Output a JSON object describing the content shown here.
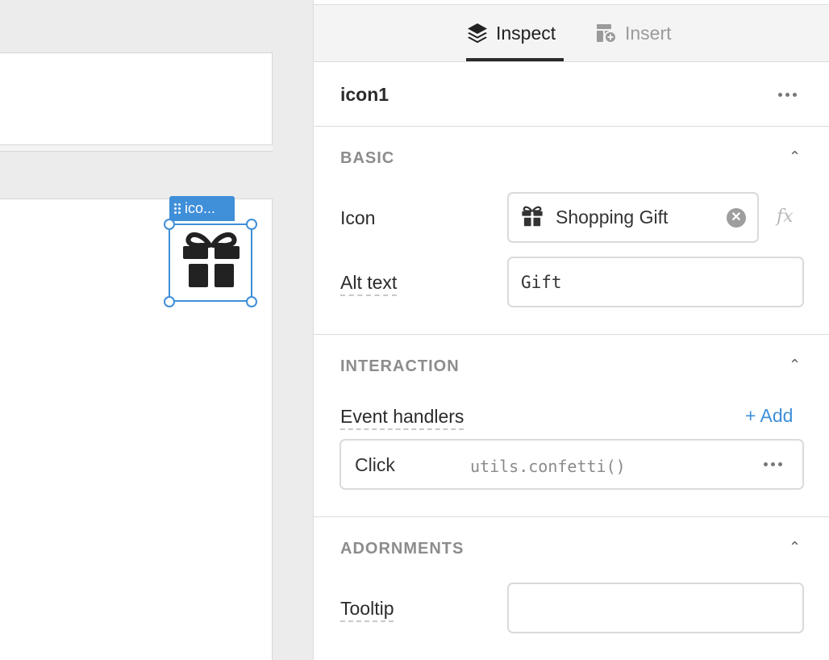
{
  "tabs": {
    "inspect_label": "Inspect",
    "insert_label": "Insert",
    "active": "inspect"
  },
  "component": {
    "name": "icon1",
    "selection_tag": "ico..."
  },
  "sections": {
    "basic": {
      "title": "BASIC",
      "icon_label": "Icon",
      "icon_value": "Shopping Gift",
      "icon_name": "gift-icon",
      "fx_label": "fx",
      "alt_label": "Alt text",
      "alt_value": "Gift"
    },
    "interaction": {
      "title": "INTERACTION",
      "handlers_label": "Event handlers",
      "add_label": "+ Add",
      "handlers": [
        {
          "event": "Click",
          "action": "utils.confetti()"
        }
      ]
    },
    "adornments": {
      "title": "ADORNMENTS",
      "tooltip_label": "Tooltip",
      "tooltip_value": ""
    }
  },
  "colors": {
    "accent": "#3f8fd9",
    "section_title": "#8c8c8c"
  }
}
